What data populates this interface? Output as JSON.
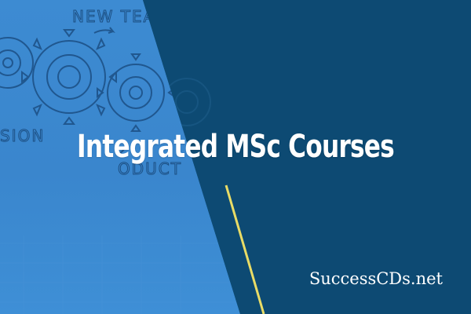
{
  "banner": {
    "title": "Integrated MSc Courses",
    "site": "SuccessCDs.net"
  },
  "background_sketch": {
    "words": [
      "NEW TEAM",
      "SION",
      "ODUCT"
    ]
  },
  "colors": {
    "left_panel": "#3d8bd2",
    "right_panel": "#0d4a73",
    "accent_line": "#e9dc66",
    "text": "#ffffff",
    "sketch_stroke": "#1c4f83"
  },
  "icons": [
    "gear-icon",
    "arrow-icon"
  ]
}
